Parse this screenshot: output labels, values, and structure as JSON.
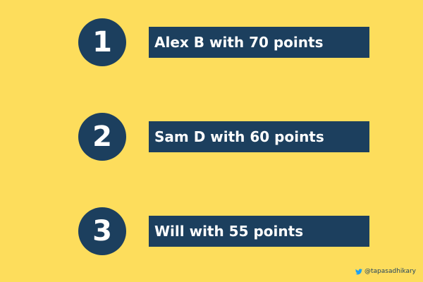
{
  "colors": {
    "background": "#FDDD5C",
    "accent": "#1C3F5E",
    "text_on_accent": "#FFFFFF"
  },
  "leaderboard": [
    {
      "rank": "1",
      "text": "Alex B with 70 points"
    },
    {
      "rank": "2",
      "text": "Sam D with 60 points"
    },
    {
      "rank": "3",
      "text": "Will with 55 points"
    }
  ],
  "credit": {
    "icon": "twitter-bird-icon",
    "handle": "@tapasadhikary"
  }
}
